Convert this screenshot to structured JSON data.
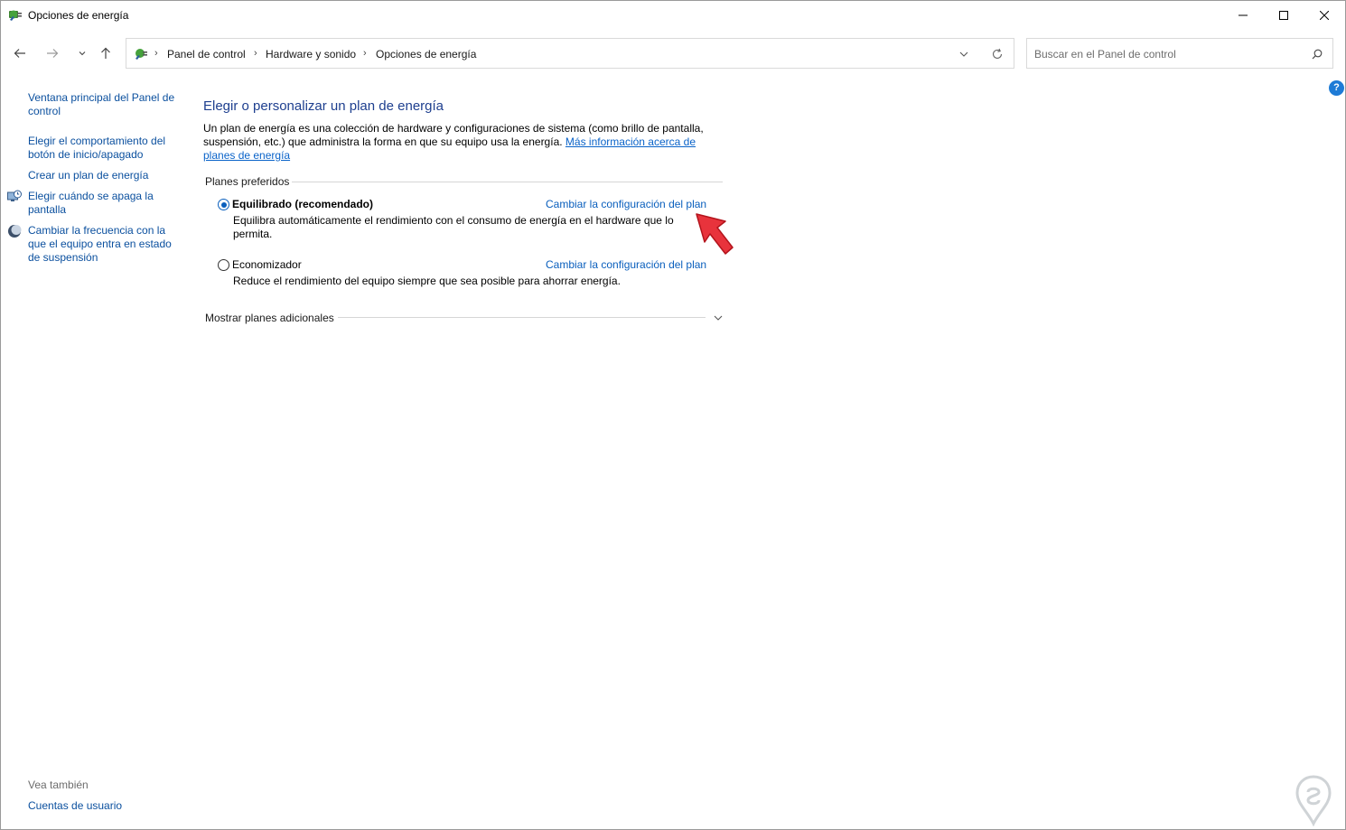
{
  "window": {
    "title": "Opciones de energía",
    "controls": {
      "minimize": "minimize-icon",
      "maximize": "maximize-icon",
      "close": "close-icon"
    }
  },
  "nav": {
    "breadcrumbs": [
      "Panel de control",
      "Hardware y sonido",
      "Opciones de energía"
    ],
    "search_placeholder": "Buscar en el Panel de control"
  },
  "sidebar": {
    "links": [
      {
        "label": "Ventana principal del Panel de control",
        "icon": null
      },
      {
        "label": "Elegir el comportamiento del botón de inicio/apagado",
        "icon": null
      },
      {
        "label": "Crear un plan de energía",
        "icon": null
      },
      {
        "label": "Elegir cuándo se apaga la pantalla",
        "icon": "monitor-clock-icon"
      },
      {
        "label": "Cambiar la frecuencia con la que el equipo entra en estado de suspensión",
        "icon": "moon-icon"
      }
    ],
    "see_also_header": "Vea también",
    "see_also_links": [
      "Cuentas de usuario"
    ]
  },
  "main": {
    "title": "Elegir o personalizar un plan de energía",
    "description": "Un plan de energía es una colección de hardware y configuraciones de sistema (como brillo de pantalla, suspensión, etc.) que administra la forma en que su equipo usa la energía.",
    "description_link": "Más información acerca de planes de energía",
    "preferred_header": "Planes preferidos",
    "plans": [
      {
        "name": "Equilibrado (recomendado)",
        "selected": true,
        "link": "Cambiar la configuración del plan",
        "description": "Equilibra automáticamente el rendimiento con el consumo de energía en el hardware que lo permita."
      },
      {
        "name": "Economizador",
        "selected": false,
        "link": "Cambiar la configuración del plan",
        "description": "Reduce el rendimiento del equipo siempre que sea posible para ahorrar energía."
      }
    ],
    "more_plans_label": "Mostrar planes adicionales"
  },
  "colors": {
    "link": "#0a4f9e",
    "title": "#1e3f8f",
    "accent": "#0a5fbd",
    "annotation_arrow": "#e8333c"
  }
}
